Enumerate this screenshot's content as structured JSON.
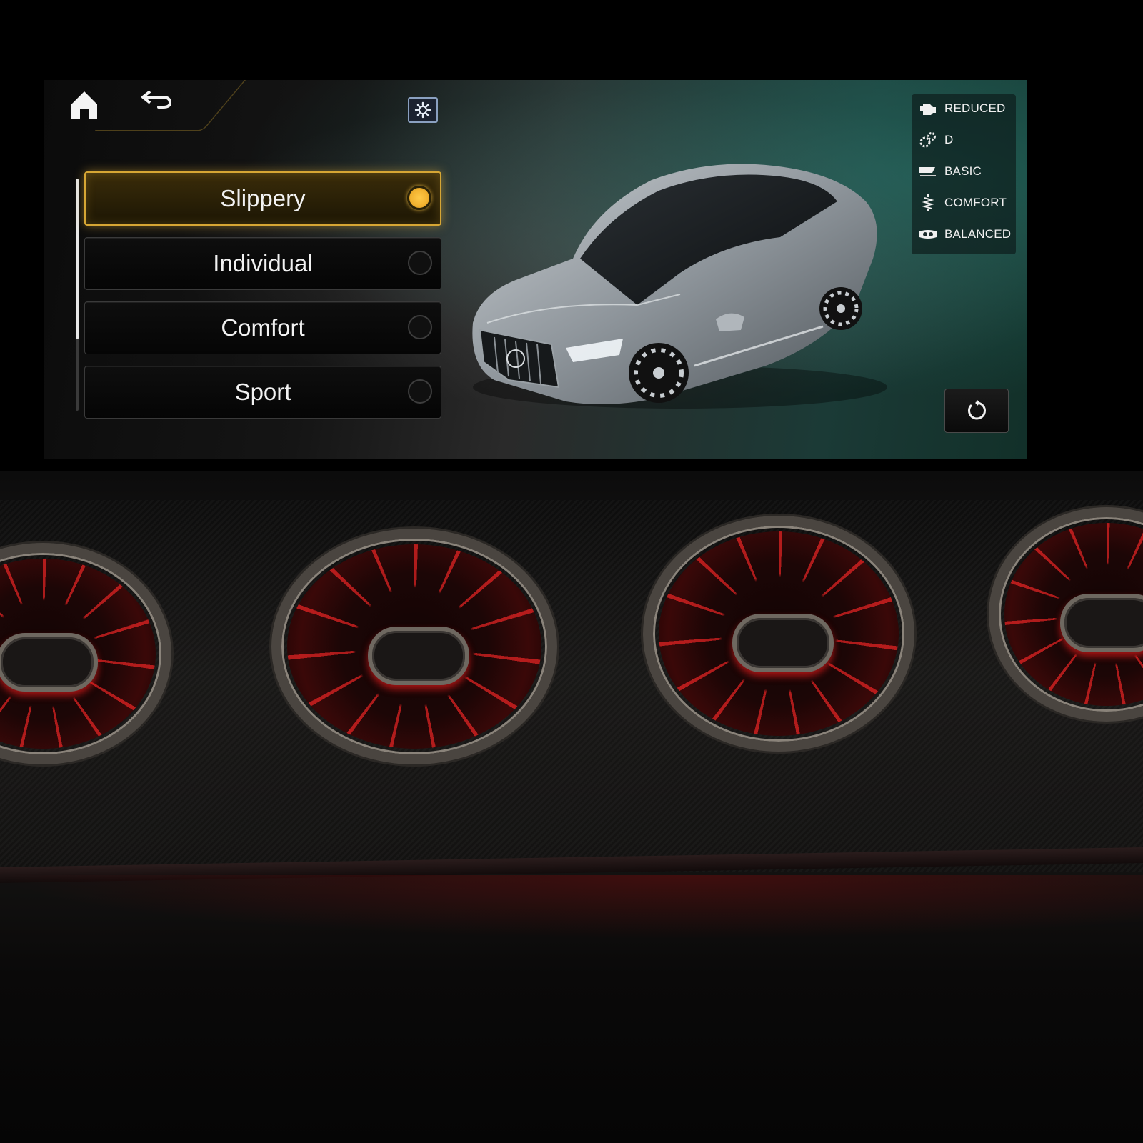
{
  "screen": {
    "nav": {
      "home_icon": "home-icon",
      "back_icon": "back-arrow-icon"
    },
    "dynamic_select_icon": "gear-settings-icon",
    "drive_modes": [
      {
        "label": "Slippery",
        "selected": true
      },
      {
        "label": "Individual",
        "selected": false
      },
      {
        "label": "Comfort",
        "selected": false
      },
      {
        "label": "Sport",
        "selected": false
      }
    ],
    "status": [
      {
        "icon": "engine-icon",
        "value": "REDUCED"
      },
      {
        "icon": "transmission-gears-icon",
        "value": "D"
      },
      {
        "icon": "amg-dynamics-icon",
        "value": "BASIC"
      },
      {
        "icon": "suspension-icon",
        "value": "COMFORT"
      },
      {
        "icon": "exhaust-icon",
        "value": "BALANCED"
      }
    ],
    "reset_icon": "reset-icon",
    "vehicle_image": "car-illustration",
    "colors": {
      "accent": "#d6a634",
      "selected_dot": "#f1b12f",
      "text": "#f2f2f2"
    }
  },
  "surroundings": {
    "vents": 4,
    "vent_light_color": "#ff2a2a"
  }
}
